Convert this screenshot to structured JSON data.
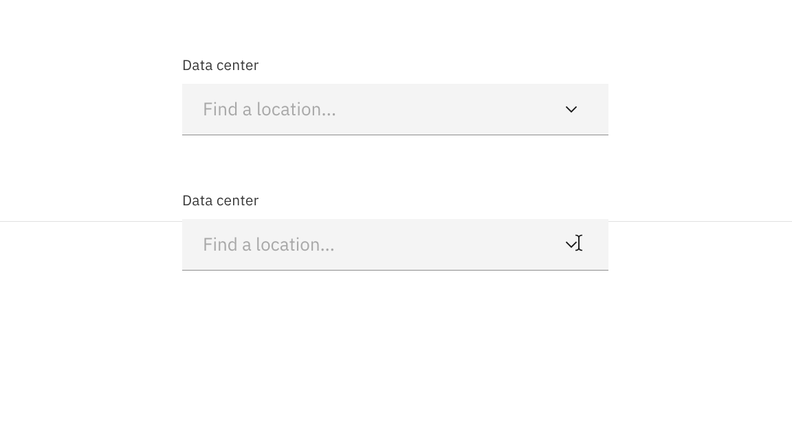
{
  "field1": {
    "label": "Data center",
    "placeholder": "Find a location..."
  },
  "field2": {
    "label": "Data center",
    "placeholder": "Find a location..."
  }
}
